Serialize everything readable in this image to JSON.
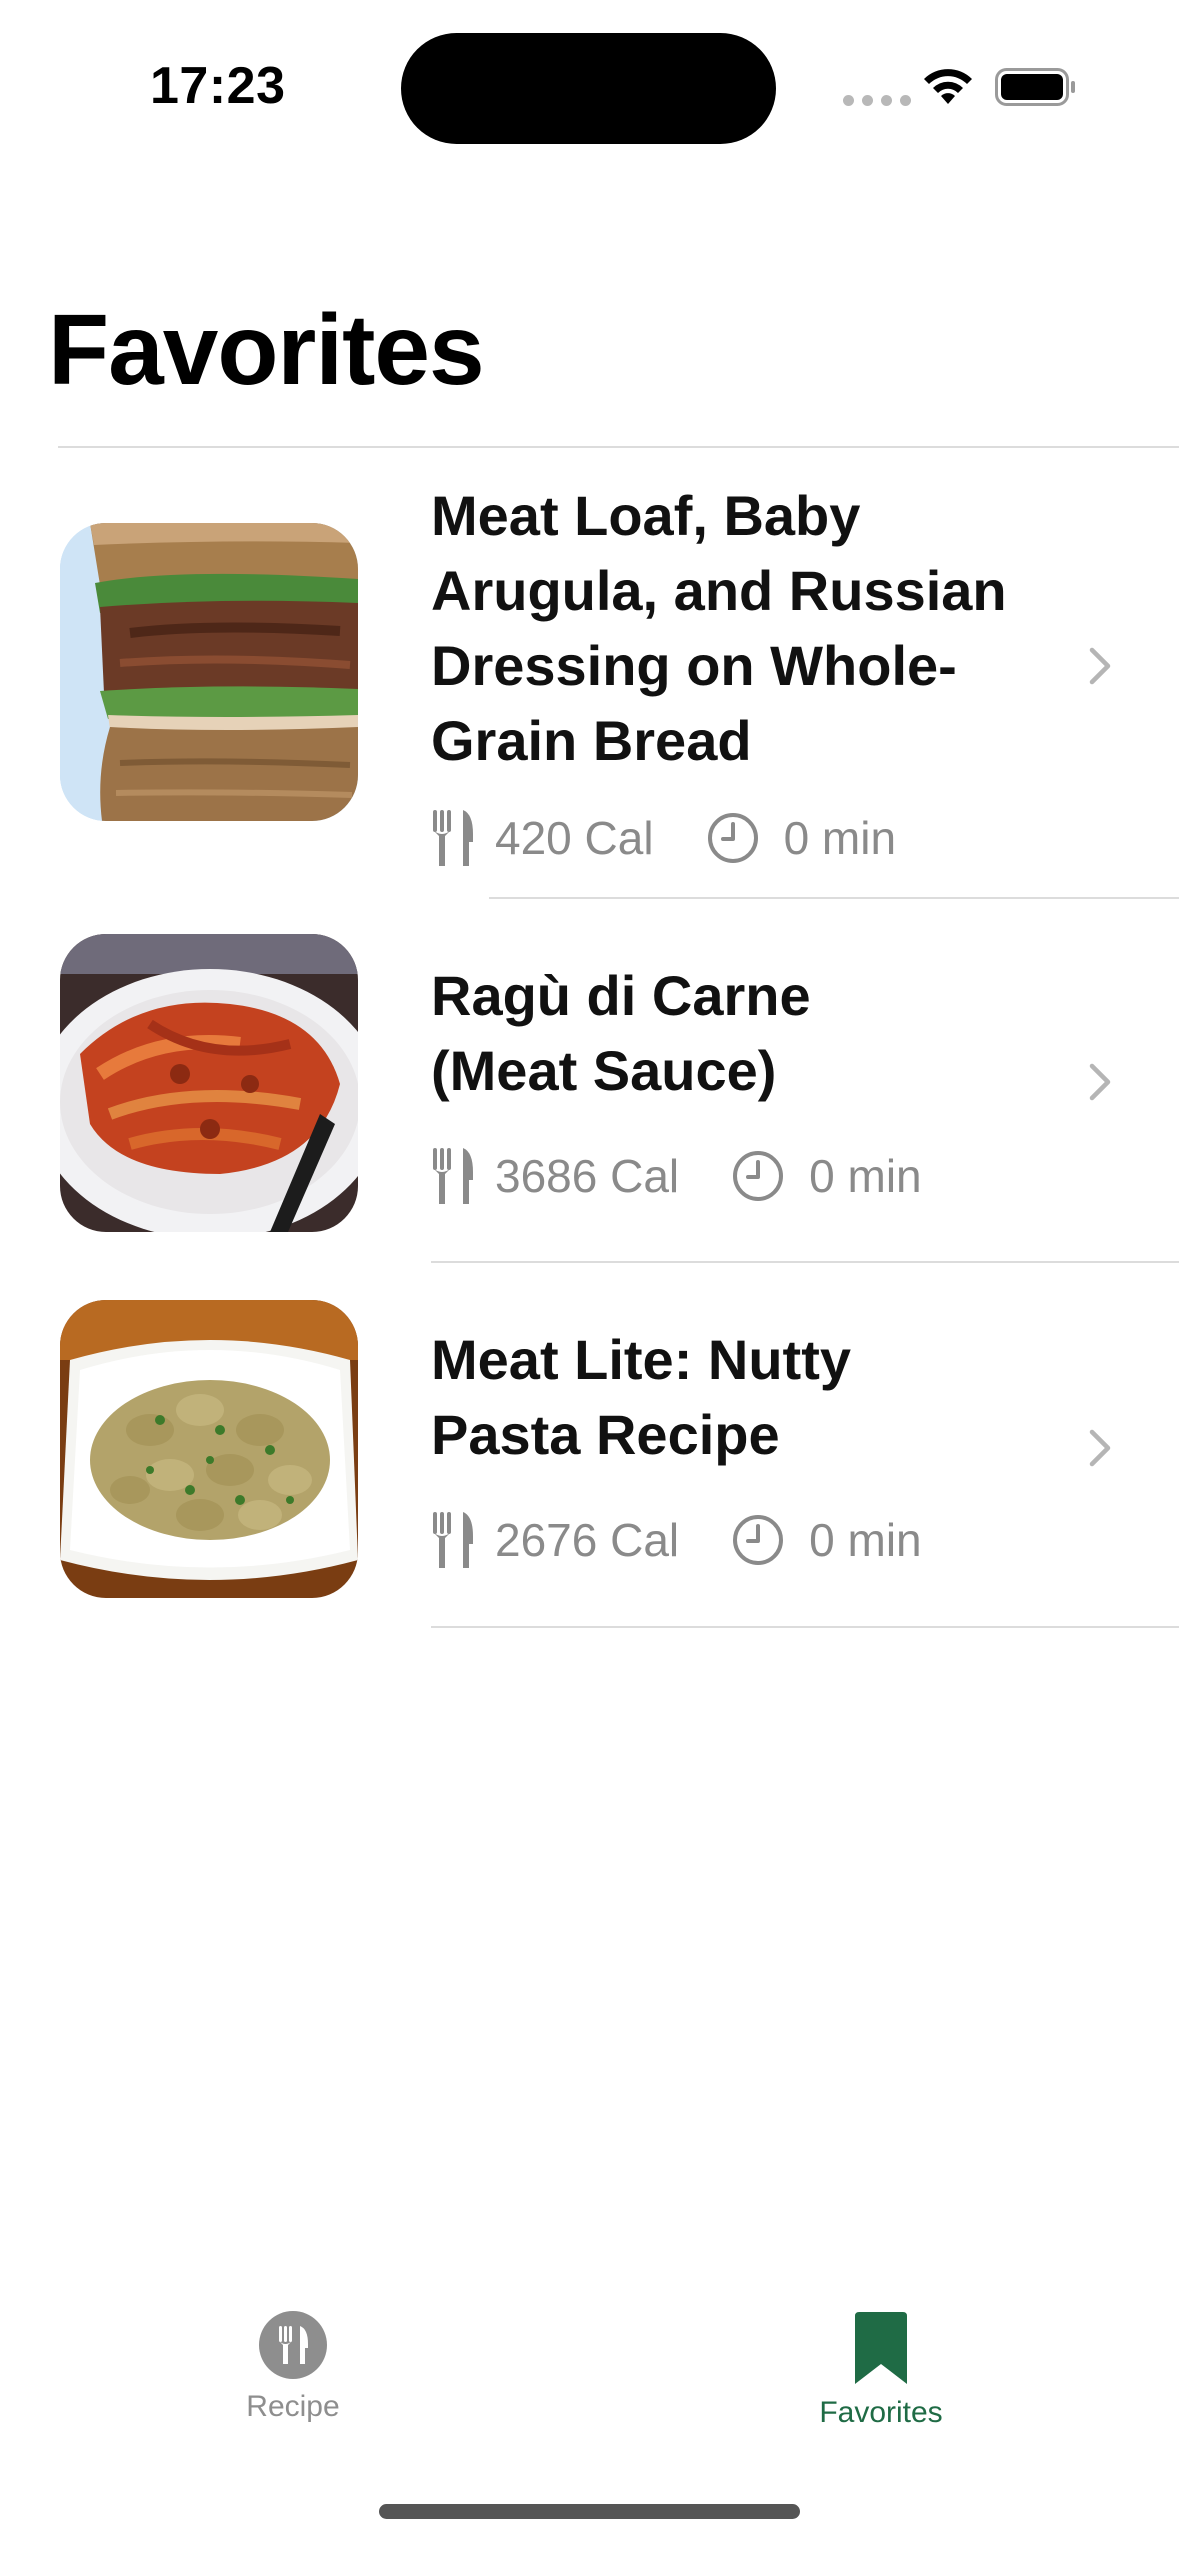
{
  "status_bar": {
    "time": "17:23"
  },
  "page": {
    "title": "Favorites"
  },
  "recipes": [
    {
      "title_lines": [
        "Meat Loaf, Baby",
        "Arugula, and Russian",
        "Dressing on Whole-",
        "Grain Bread"
      ],
      "calories": "420 Cal",
      "time": "0 min",
      "image": "meatloaf-sandwich"
    },
    {
      "title_lines": [
        "Ragù di Carne",
        "(Meat Sauce)"
      ],
      "calories": "3686 Cal",
      "time": "0 min",
      "image": "pasta-meat-sauce"
    },
    {
      "title_lines": [
        "Meat Lite: Nutty",
        "Pasta Recipe"
      ],
      "calories": "2676 Cal",
      "time": "0 min",
      "image": "nutty-pasta"
    }
  ],
  "tab_bar": {
    "tabs": [
      {
        "label": "Recipe",
        "icon": "fork-knife-icon",
        "selected": false
      },
      {
        "label": "Favorites",
        "icon": "bookmark-icon",
        "selected": true
      }
    ]
  },
  "colors": {
    "accent": "#1f6b45",
    "secondary_text": "#8a8a8a",
    "inactive_tab": "#8e8e8e",
    "divider": "#dcdcdc"
  }
}
